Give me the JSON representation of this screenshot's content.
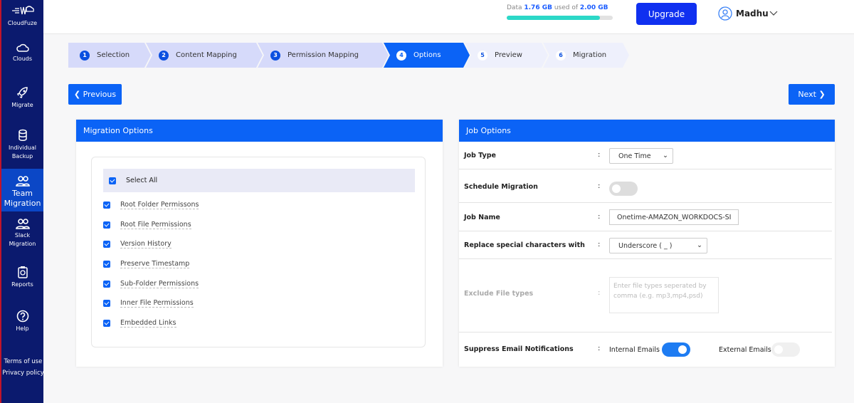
{
  "sidebar": {
    "brand": "CloudFuze",
    "items": [
      {
        "label": "Clouds"
      },
      {
        "label": "Migrate"
      },
      {
        "label": "Individual Backup"
      },
      {
        "label": "Team Migration"
      },
      {
        "label": "Slack Migration"
      },
      {
        "label": "Reports"
      },
      {
        "label": "Help"
      }
    ],
    "terms": "Terms of use",
    "privacy": "Privacy policy"
  },
  "header": {
    "data_prefix": "Data",
    "used": "1.76 GB",
    "used_of": "used of",
    "total": "2.00 GB",
    "usage_percent": 88,
    "upgrade": "Upgrade",
    "user": "Madhu"
  },
  "steps": [
    {
      "n": "1",
      "label": "Selection"
    },
    {
      "n": "2",
      "label": "Content Mapping"
    },
    {
      "n": "3",
      "label": "Permission Mapping"
    },
    {
      "n": "4",
      "label": "Options"
    },
    {
      "n": "5",
      "label": "Preview"
    },
    {
      "n": "6",
      "label": "Migration"
    }
  ],
  "nav": {
    "previous": "Previous",
    "next": "Next"
  },
  "migration_options": {
    "title": "Migration Options",
    "select_all": "Select All",
    "items": [
      "Root Folder Permissons",
      "Root File Permissions",
      "Version History",
      "Preserve Timestamp",
      "Sub-Folder Permissions",
      "Inner File Permissions",
      "Embedded Links"
    ]
  },
  "job_options": {
    "title": "Job Options",
    "job_type_label": "Job Type",
    "job_type_value": "One Time",
    "schedule_label": "Schedule Migration",
    "schedule_on": false,
    "job_name_label": "Job Name",
    "job_name_value": "Onetime-AMAZON_WORKDOCS-SI",
    "replace_label": "Replace special characters with",
    "replace_value": "Underscore ( _ )",
    "exclude_label": "Exclude File types",
    "exclude_placeholder": "Enter file types seperated by comma (e.g. mp3,mp4,psd)",
    "suppress_label": "Suppress Email Notifications",
    "internal_label": "Internal Emails",
    "internal_on": true,
    "external_label": "External Emails",
    "external_on": false,
    "colon": ":"
  },
  "colors": {
    "sidebar": "#0b1a6e",
    "accent": "#0b63f6",
    "upgrade": "#1030f0",
    "progress": "#2cd8c8"
  }
}
